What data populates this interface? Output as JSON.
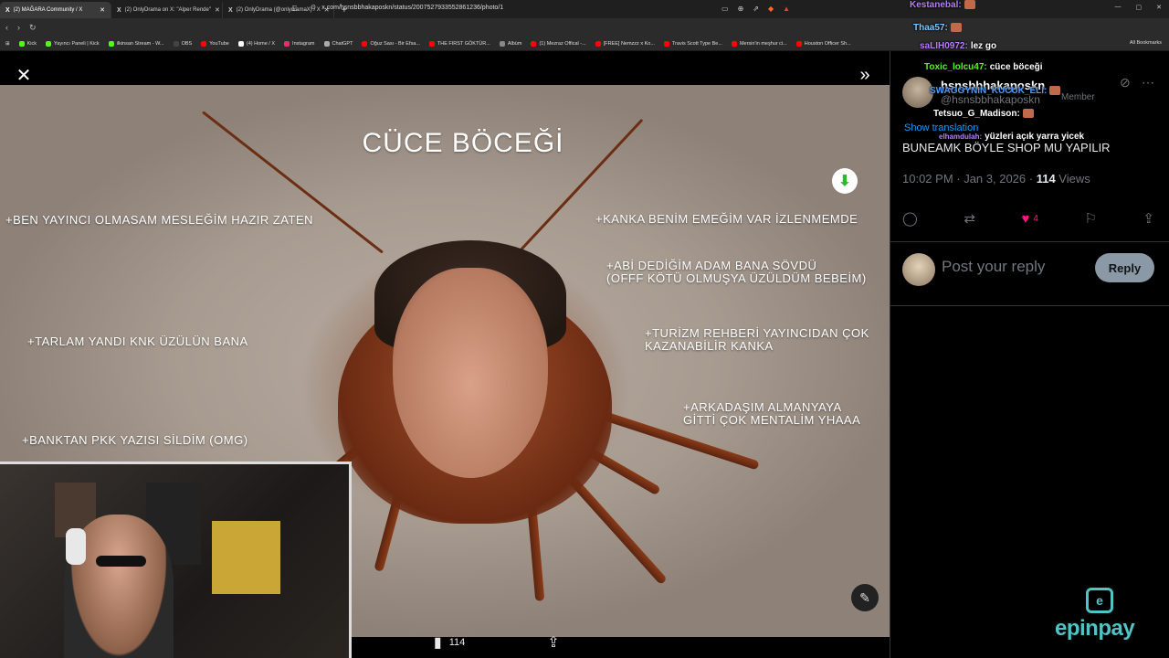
{
  "browser": {
    "tabs": [
      {
        "label": "(2) MAĞARA Community / X",
        "active": true
      },
      {
        "label": "(2) OnlyDrama on X: \"Alper Rende\"",
        "active": false
      },
      {
        "label": "(2) OnlyDrama (@onlydramaX) / X",
        "active": false
      }
    ],
    "new_tab": "+",
    "url": "x.com/hsnsbbhakaposkn/status/2007527933552861236/photo/1",
    "bookmarks": [
      {
        "label": "Kick",
        "color": "#53fc18"
      },
      {
        "label": "Yayıncı Paneli | Kick",
        "color": "#53fc18"
      },
      {
        "label": "ilkinsan Stream - W...",
        "color": "#53fc18"
      },
      {
        "label": "OBS",
        "color": "#444444"
      },
      {
        "label": "YouTube",
        "color": "#ff0000"
      },
      {
        "label": "(4) Home / X",
        "color": "#ffffff"
      },
      {
        "label": "Instagram",
        "color": "#e1306c"
      },
      {
        "label": "ChatGPT",
        "color": "#aaaaaa"
      },
      {
        "label": "Oğuz Sası - Bir Efsa...",
        "color": "#ff0000"
      },
      {
        "label": "THE FIRST GÖKTÜR...",
        "color": "#ff0000"
      },
      {
        "label": "Albüm",
        "color": "#888888"
      },
      {
        "label": "(1) Mezraz Offical -...",
        "color": "#ff0000"
      },
      {
        "label": "[FREE] Nemzzz x Ko...",
        "color": "#ff0000"
      },
      {
        "label": "Travis Scott Type Be...",
        "color": "#ff0000"
      },
      {
        "label": "Mersin'in meşhur ci...",
        "color": "#ff0000"
      },
      {
        "label": "Houston Officer Sh...",
        "color": "#ff0000"
      }
    ],
    "all_bookmarks": "All Bookmarks"
  },
  "viewer": {
    "meme_title": "CÜCE BÖCEĞİ",
    "meme_lines": [
      "+BEN YAYINCI OLMASAM MESLEĞİM HAZIR ZATEN",
      "+TARLAM YANDI KNK ÜZÜLÜN BANA",
      "+BANKTAN PKK YAZISI SİLDİM (OMG)",
      "+KANKA BENİM EMEĞİM VAR İZLENMEMDE",
      "+ABİ DEDİĞİM ADAM BANA SÖVDÜ",
      "(OFFF KÖTÜ OLMUŞYA ÜZÜLDÜM BEBEİM)",
      "+TURİZM REHBERİ YAYINCIDAN ÇOK",
      "KAZANABİLİR KANKA",
      "+ARKADAŞIM ALMANYAYA",
      "GİTTİ ÇOK MENTALİM YHAAA"
    ],
    "likes": "4",
    "views": "114"
  },
  "tweet": {
    "username": "hsnsbbhakaposkn",
    "handle": "@hsnsbbhakaposkn",
    "badge": "Member",
    "show_translation": "Show translation",
    "text": "BUNEAMK BÖYLE SHOP MU YAPILIR",
    "time": "10:02 PM · Jan 3, 2026 · ",
    "views_count": "114",
    "views_label": " Views",
    "likes": "4",
    "reply_placeholder": "Post your reply",
    "reply_button": "Reply"
  },
  "chat": [
    {
      "name": "Kestanebal:",
      "text": "",
      "color": "#b77dff"
    },
    {
      "name": "Thaa57:",
      "text": "",
      "color": "#7ec8ff"
    },
    {
      "name": "saLIH0972:",
      "text": "lez go",
      "color": "#b77dff"
    },
    {
      "name": "Toxic_lolcu47:",
      "text": "cüce böceği",
      "color": "#53fc18"
    },
    {
      "name": "SWAGGYNIN_KUCUK_ELI:",
      "text": "",
      "color": "#4f9cff"
    },
    {
      "name": "Tetsuo_G_Madison:",
      "text": "",
      "color": "#ffffff"
    },
    {
      "name": "elhamdulah:",
      "text": "yüzleri açık yarra yicek",
      "color": "#b77dff"
    }
  ],
  "sponsor": {
    "name": "epinpay",
    "mark": "e"
  },
  "colors": {
    "accent": "#1d9bf0",
    "like": "#f91880",
    "sponsor": "#4fc3c5"
  }
}
